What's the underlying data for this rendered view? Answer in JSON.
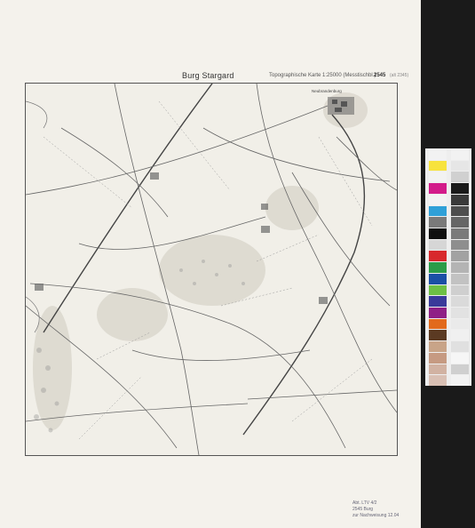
{
  "sheet": {
    "title": "Burg Stargard",
    "subtitle": "Topographische Karte 1:25000 (Messtischbl.)",
    "sheet_number": "2545",
    "sheet_extra": "(alt 2345)"
  },
  "map": {
    "town_label": "Neubrandenburg"
  },
  "stamp": {
    "lines": [
      "Abt. LTV 4/2",
      "2545 Burg",
      "zur Nachweisung 12.04"
    ]
  },
  "colorbar": {
    "left_colors": [
      "#f2f2f2",
      "#f7e33d",
      "#f2f2f2",
      "#d31b8a",
      "#f2f2f2",
      "#2fa0d8",
      "#7a7a7a",
      "#101010",
      "#d6d6d6",
      "#d8282c",
      "#2c9c48",
      "#1a4fa5",
      "#6dbf45",
      "#3a3a9a",
      "#8f1f86",
      "#e26a1c",
      "#5b3a22",
      "#c8a488",
      "#c69a82",
      "#d1b2a2",
      "#d9c0b4"
    ],
    "right_colors": [
      "#f2f2f2",
      "#e6e6e6",
      "#d0d0d0",
      "#1a1a1a",
      "#3a3a3a",
      "#4e4e4e",
      "#666666",
      "#7a7a7a",
      "#8e8e8e",
      "#a2a2a2",
      "#b4b4b4",
      "#c2c2c2",
      "#cfcfcf",
      "#dadada",
      "#e2e2e2",
      "#eaeaea",
      "#f0f0f0",
      "#e0e0e0",
      "#f6f6f6",
      "#cfcfcf",
      "#f2f2f2"
    ]
  }
}
